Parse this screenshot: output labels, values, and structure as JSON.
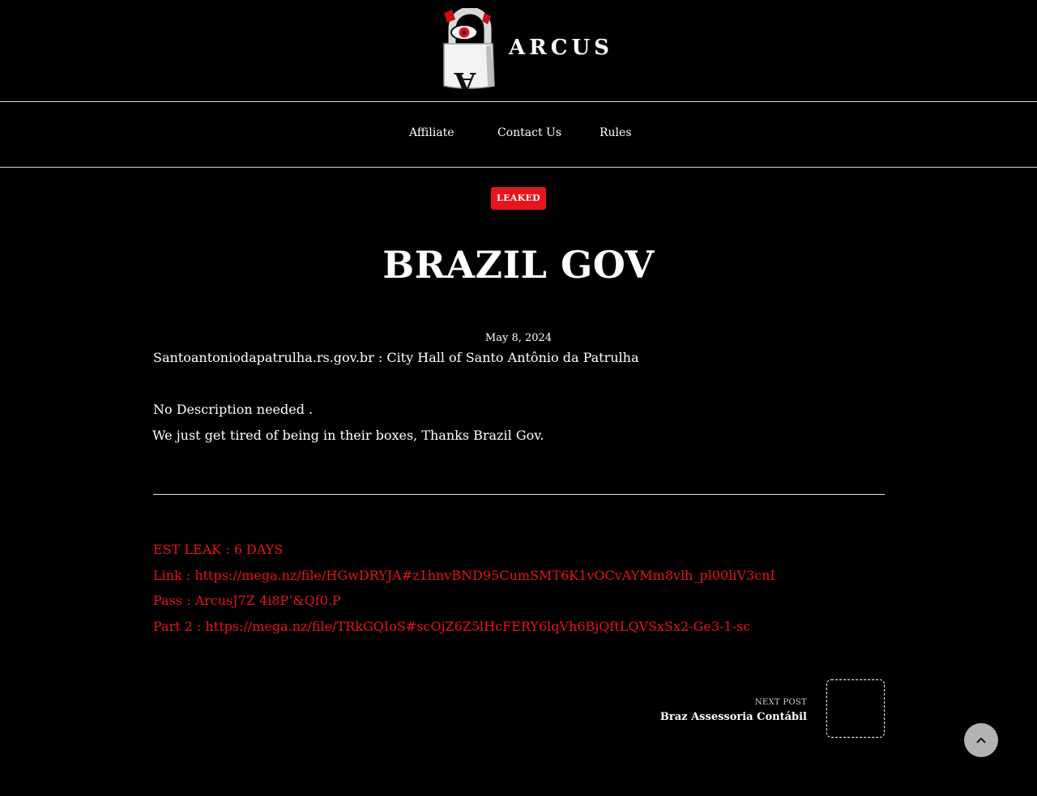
{
  "site": {
    "name": "ARCUS",
    "logo_icon": "padlock-eye-logo"
  },
  "nav": {
    "items": [
      {
        "label": "Affiliate"
      },
      {
        "label": "Contact Us"
      },
      {
        "label": "Rules"
      }
    ]
  },
  "post": {
    "category": "LEAKED",
    "title": "BRAZIL GOV",
    "date": "May 8, 2024",
    "paragraphs": [
      "Santoantoniodapatrulha.rs.gov.br : City Hall of Santo Antônio da Patrulha",
      "No Description needed .",
      "We just get tired of being in their boxes, Thanks Brazil Gov."
    ],
    "leak": {
      "est_leak": "EST LEAK : 6 DAYS",
      "link_prefix": "Link : ",
      "link_url": "https://mega.nz/file/HGwDRYJA#z1hnvBND95CumSMT6K1vOCvAYMm8vlh_pl00liV3cnI",
      "pass": "Pass : ArcusJ7Z 4i8P’&Qf0.P",
      "part2_prefix": "Part 2 : ",
      "part2_url": "https://mega.nz/file/TRkGQIoS#scOjZ6Z5lHcFERY6lqVh6BjQftLQVSxSx2-Ge3-1-sc"
    }
  },
  "next_post": {
    "label": "NEXT POST",
    "title": "Braz Assessoria Contábil"
  },
  "scroll_top": {
    "icon": "chevron-up-icon"
  },
  "colors": {
    "background": "#000000",
    "accent": "#e8141b",
    "text": "#ffffff",
    "scroll_button": "#b3b3b3"
  }
}
